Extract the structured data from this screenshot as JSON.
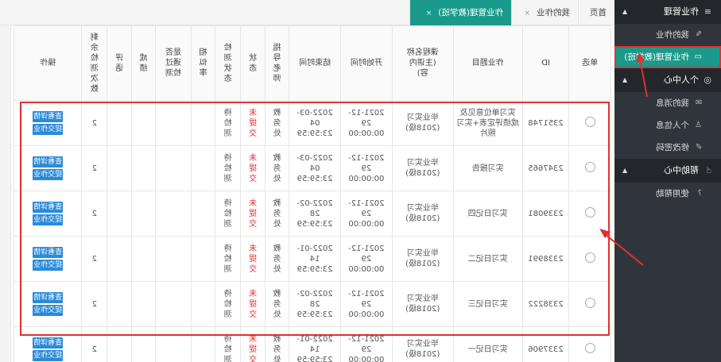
{
  "sidebar": {
    "sections": [
      {
        "label": "作业管理",
        "icon": "menu-icon",
        "items": [
          {
            "label": "我的作业",
            "icon": "edit-icon"
          },
          {
            "label": "作业管理(教学班)",
            "icon": "monitor-icon",
            "active": true
          }
        ]
      },
      {
        "label": "个人中心",
        "icon": "user-circle-icon",
        "items": [
          {
            "label": "我的消息",
            "icon": "mail-icon"
          },
          {
            "label": "个人信息",
            "icon": "person-icon"
          },
          {
            "label": "修改密码",
            "icon": "pencil-icon"
          }
        ]
      },
      {
        "label": "帮助中心",
        "icon": "hand-icon",
        "items": [
          {
            "label": "使用帮助",
            "icon": "help-icon"
          }
        ]
      }
    ]
  },
  "tabs": [
    {
      "label": "首页",
      "active": false,
      "closable": false
    },
    {
      "label": "我的作业",
      "active": false,
      "closable": true
    },
    {
      "label": "作业管理(教学班)",
      "active": true,
      "closable": true
    }
  ],
  "table": {
    "headers": [
      "单选",
      "ID",
      "作业题目",
      "课程名称\n(主讲内\n容)",
      "开始时间",
      "结束时间",
      "指\n导\n老\n师",
      "状\n态",
      "检\n测\n状\n态",
      "相\n似\n率",
      "是否\n通过\n检测",
      "成\n绩",
      "评\n语",
      "剩\n余\n检\n测\n次\n数",
      "操作"
    ],
    "rows": [
      {
        "id": "2351748",
        "title": "实习单位意见及\n成绩评定表+实习\n照片",
        "course": "毕业实习\n(2018级)",
        "start": "2021-12-\n29\n00:00:00",
        "end": "2022-03-\n04\n23:59:59",
        "teacher": "教\n务\n处",
        "status": "未\n提\n交",
        "check": "待\n检\n测",
        "sim": "",
        "pass": "",
        "score": "",
        "comment": "",
        "remain": "2"
      },
      {
        "id": "2347665",
        "title": "实习报告",
        "course": "毕业实习\n(2018级)",
        "start": "2021-12-\n29\n00:00:00",
        "end": "2022-03-\n04\n23:59:59",
        "teacher": "教\n务\n处",
        "status": "未\n提\n交",
        "check": "待\n检\n测",
        "sim": "",
        "pass": "",
        "score": "",
        "comment": "",
        "remain": "2"
      },
      {
        "id": "2339081",
        "title": "实习日记四",
        "course": "毕业实习\n(2018级)",
        "start": "2021-12-\n29\n00:00:00",
        "end": "2022-02-\n28\n23:59:59",
        "teacher": "教\n务\n处",
        "status": "未\n提\n交",
        "check": "待\n检\n测",
        "sim": "",
        "pass": "",
        "score": "",
        "comment": "",
        "remain": "2"
      },
      {
        "id": "2338991",
        "title": "实习日记二",
        "course": "毕业实习\n(2018级)",
        "start": "2021-12-\n29\n00:00:00",
        "end": "2022-01-\n14\n23:59:59",
        "teacher": "教\n务\n处",
        "status": "未\n提\n交",
        "check": "待\n检\n测",
        "sim": "",
        "pass": "",
        "score": "",
        "comment": "",
        "remain": "2"
      },
      {
        "id": "2338222",
        "title": "实习日记三",
        "course": "毕业实习\n(2018级)",
        "start": "2021-12-\n29\n00:00:00",
        "end": "2022-02-\n28\n23:59:59",
        "teacher": "教\n务\n处",
        "status": "未\n提\n交",
        "check": "待\n检\n测",
        "sim": "",
        "pass": "",
        "score": "",
        "comment": "",
        "remain": "2"
      },
      {
        "id": "2337906",
        "title": "实习日记一",
        "course": "毕业实习\n(2018级)",
        "start": "2021-12-\n29\n00:00:00",
        "end": "2022-01-\n14\n23:59:59",
        "teacher": "教\n务\n处",
        "status": "未\n提\n交",
        "check": "待\n检\n测",
        "sim": "",
        "pass": "",
        "score": "",
        "comment": "",
        "remain": "2"
      }
    ],
    "actions": {
      "view": "查看详情",
      "submit": "提交作业"
    }
  },
  "colors": {
    "accent": "#1a9a8a",
    "sidebar_bg": "#30353c",
    "button": "#2b8ad8",
    "highlight": "#e23030"
  }
}
